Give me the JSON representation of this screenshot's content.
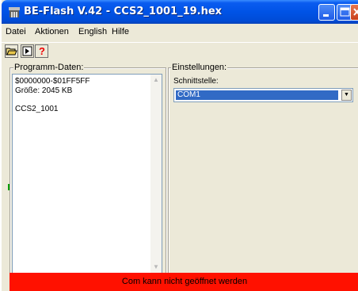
{
  "window": {
    "title": "BE-Flash V.42 - CCS2_1001_19.hex"
  },
  "menu": {
    "items": [
      "Datei",
      "Aktionen",
      "English",
      "Hilfe"
    ]
  },
  "toolbar": {
    "buttons": [
      "open-folder-icon",
      "play-icon",
      "help-icon"
    ],
    "help_glyph": "?"
  },
  "program": {
    "group_label": "Programm-Daten:",
    "lines": [
      "$0000000-$01FF5FF",
      "Größe: 2045 KB",
      "",
      "CCS2_1001"
    ]
  },
  "settings": {
    "group_label": "Einstellungen:",
    "interface_label": "Schnittstelle:",
    "interface_value": "COM1"
  },
  "status": {
    "message": "Com kann nicht geöffnet werden",
    "color": "#ff1100"
  }
}
